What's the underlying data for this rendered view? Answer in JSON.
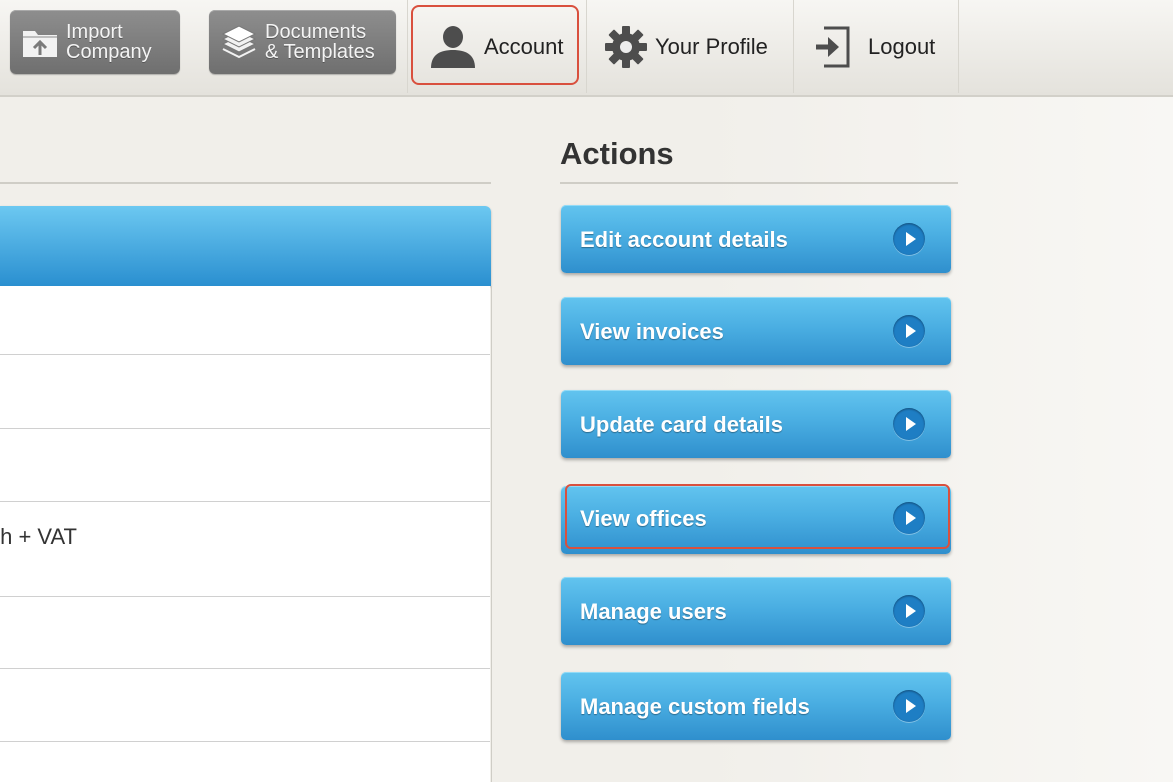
{
  "toolbar": {
    "import_company": {
      "line1": "Import",
      "line2": "Company",
      "icon": "folder-upload-icon"
    },
    "documents_templates": {
      "line1": "Documents",
      "line2": "& Templates",
      "icon": "document-stack-icon"
    },
    "account_tab": {
      "label": "Account",
      "icon": "user-icon",
      "selected": true
    },
    "profile_tab": {
      "label": "Your Profile",
      "icon": "gear-icon"
    },
    "logout_tab": {
      "label": "Logout",
      "icon": "logout-icon"
    }
  },
  "left_panel": {
    "rows": [
      {
        "text": ""
      },
      {
        "text": ""
      },
      {
        "text": ""
      },
      {
        "text": "th + VAT"
      },
      {
        "text": ""
      },
      {
        "text": ""
      },
      {
        "text": ""
      }
    ]
  },
  "actions": {
    "title": "Actions",
    "buttons": [
      {
        "label": "Edit account details"
      },
      {
        "label": "View invoices"
      },
      {
        "label": "Update card details"
      },
      {
        "label": "View offices",
        "highlighted": true
      },
      {
        "label": "Manage users"
      },
      {
        "label": "Manage custom fields"
      }
    ]
  },
  "colors": {
    "accent_blue": "#3a9fdb",
    "highlight_red": "#d9503e",
    "toolbar_gray": "#7e7e7e"
  }
}
